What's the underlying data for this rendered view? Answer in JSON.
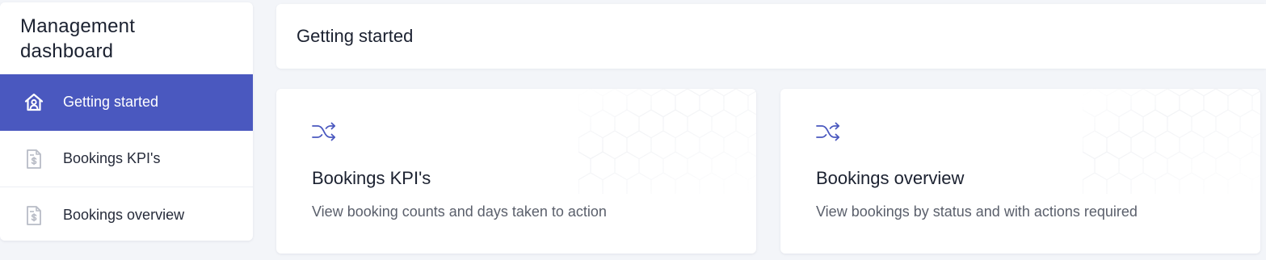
{
  "sidebar": {
    "title": "Management dashboard",
    "items": [
      {
        "label": "Getting started",
        "icon": "home-person-icon",
        "active": true
      },
      {
        "label": "Bookings KPI's",
        "icon": "invoice-dollar-icon",
        "active": false
      },
      {
        "label": "Bookings overview",
        "icon": "invoice-dollar-icon",
        "active": false
      }
    ]
  },
  "header": {
    "title": "Getting started"
  },
  "cards": [
    {
      "icon": "shuffle-icon",
      "title": "Bookings KPI's",
      "description": "View booking counts and days taken to action"
    },
    {
      "icon": "shuffle-icon",
      "title": "Bookings overview",
      "description": "View bookings by status and with actions required"
    }
  ],
  "colors": {
    "accent": "#4a58bf",
    "background": "#f3f5f9",
    "card": "#ffffff",
    "text_primary": "#1b2130",
    "text_secondary": "#5a5f6b",
    "icon_inactive": "#b8bcc6"
  }
}
